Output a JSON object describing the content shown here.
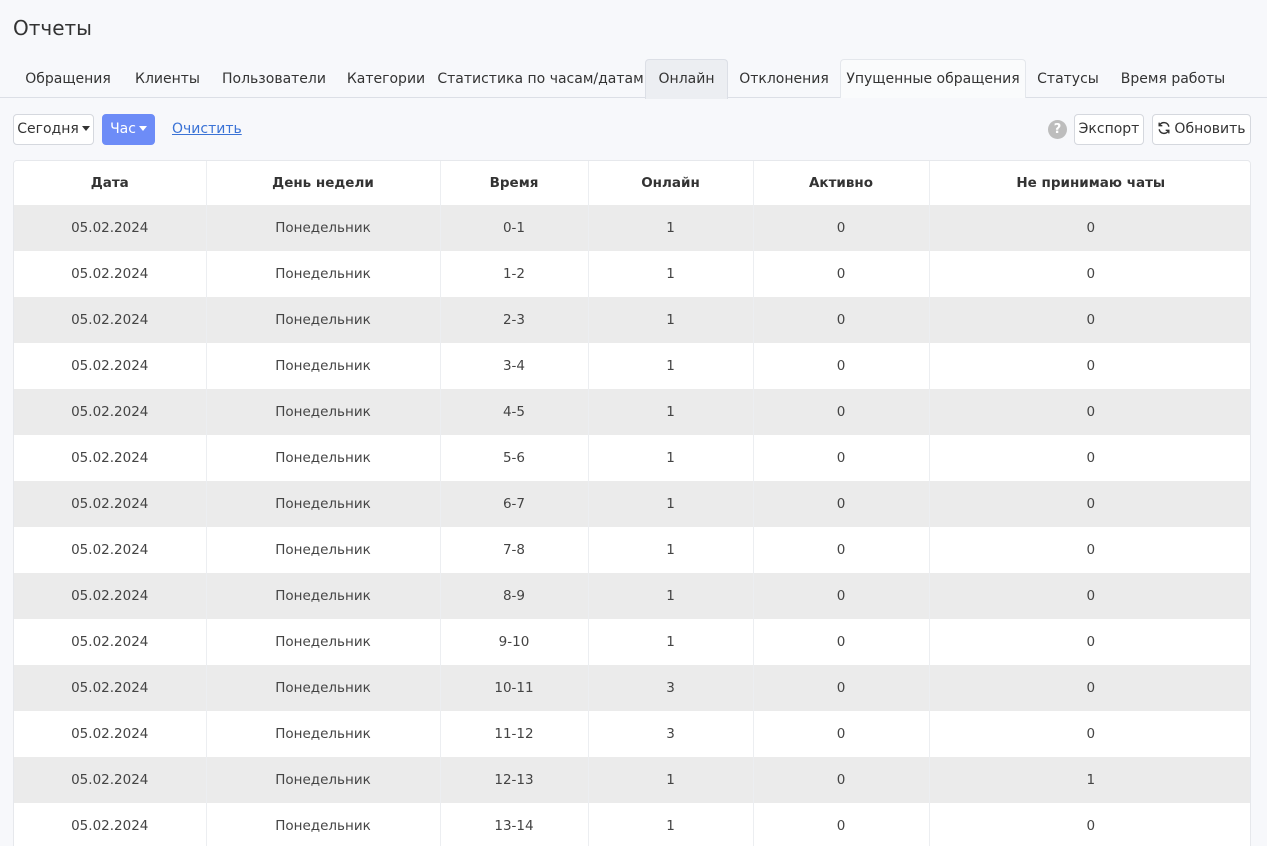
{
  "page": {
    "title": "Отчеты"
  },
  "tabs": [
    {
      "label": "Обращения",
      "state": "normal"
    },
    {
      "label": "Клиенты",
      "state": "normal"
    },
    {
      "label": "Пользователи",
      "state": "normal"
    },
    {
      "label": "Категории",
      "state": "normal"
    },
    {
      "label": "Статистика по часам/датам",
      "state": "normal"
    },
    {
      "label": "Онлайн",
      "state": "active"
    },
    {
      "label": "Отклонения",
      "state": "normal"
    },
    {
      "label": "Упущенные обращения",
      "state": "outlined"
    },
    {
      "label": "Статусы",
      "state": "normal"
    },
    {
      "label": "Время работы",
      "state": "normal"
    }
  ],
  "toolbar": {
    "period_label": "Сегодня",
    "group_label": "Час",
    "clear_label": "Очистить",
    "help_symbol": "?",
    "export_label": "Экспорт",
    "refresh_label": "Обновить",
    "accent_color": "#6d8cf7"
  },
  "table": {
    "columns": [
      "Дата",
      "День недели",
      "Время",
      "Онлайн",
      "Активно",
      "Не принимаю чаты"
    ],
    "rows": [
      [
        "05.02.2024",
        "Понедельник",
        "0-1",
        "1",
        "0",
        "0"
      ],
      [
        "05.02.2024",
        "Понедельник",
        "1-2",
        "1",
        "0",
        "0"
      ],
      [
        "05.02.2024",
        "Понедельник",
        "2-3",
        "1",
        "0",
        "0"
      ],
      [
        "05.02.2024",
        "Понедельник",
        "3-4",
        "1",
        "0",
        "0"
      ],
      [
        "05.02.2024",
        "Понедельник",
        "4-5",
        "1",
        "0",
        "0"
      ],
      [
        "05.02.2024",
        "Понедельник",
        "5-6",
        "1",
        "0",
        "0"
      ],
      [
        "05.02.2024",
        "Понедельник",
        "6-7",
        "1",
        "0",
        "0"
      ],
      [
        "05.02.2024",
        "Понедельник",
        "7-8",
        "1",
        "0",
        "0"
      ],
      [
        "05.02.2024",
        "Понедельник",
        "8-9",
        "1",
        "0",
        "0"
      ],
      [
        "05.02.2024",
        "Понедельник",
        "9-10",
        "1",
        "0",
        "0"
      ],
      [
        "05.02.2024",
        "Понедельник",
        "10-11",
        "3",
        "0",
        "0"
      ],
      [
        "05.02.2024",
        "Понедельник",
        "11-12",
        "3",
        "0",
        "0"
      ],
      [
        "05.02.2024",
        "Понедельник",
        "12-13",
        "1",
        "0",
        "1"
      ],
      [
        "05.02.2024",
        "Понедельник",
        "13-14",
        "1",
        "0",
        "0"
      ]
    ]
  }
}
